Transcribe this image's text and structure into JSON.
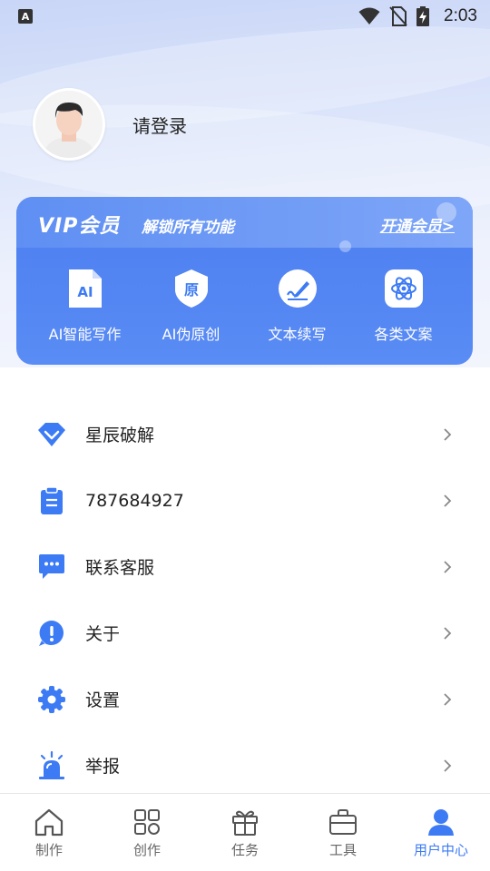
{
  "status_bar": {
    "app_badge": "A",
    "time": "2:03",
    "icons": [
      "wifi-icon",
      "no-sim-icon",
      "battery-charging-icon"
    ]
  },
  "profile": {
    "login_label": "请登录",
    "avatar_icon": "user-avatar"
  },
  "vip": {
    "title": "VIP会员",
    "subtitle": "解锁所有功能",
    "open_label": "开通会员>",
    "features": [
      {
        "label": "AI智能写作",
        "icon": "ai-document-icon"
      },
      {
        "label": "AI伪原创",
        "icon": "original-shield-icon"
      },
      {
        "label": "文本续写",
        "icon": "pen-writing-icon"
      },
      {
        "label": "各类文案",
        "icon": "atom-icon"
      }
    ]
  },
  "menu": {
    "items": [
      {
        "label": "星辰破解",
        "icon": "diamond-icon"
      },
      {
        "label": "787684927",
        "icon": "clipboard-icon"
      },
      {
        "label": "联系客服",
        "icon": "chat-icon"
      },
      {
        "label": "关于",
        "icon": "info-bubble-icon"
      },
      {
        "label": "设置",
        "icon": "gear-icon"
      },
      {
        "label": "举报",
        "icon": "alarm-siren-icon"
      }
    ]
  },
  "bottom_nav": {
    "items": [
      {
        "label": "制作",
        "icon": "home-icon"
      },
      {
        "label": "创作",
        "icon": "apps-grid-icon"
      },
      {
        "label": "任务",
        "icon": "gift-icon"
      },
      {
        "label": "工具",
        "icon": "briefcase-icon"
      },
      {
        "label": "用户中心",
        "icon": "user-icon"
      }
    ],
    "active_index": 4
  },
  "colors": {
    "accent": "#3d7bf5",
    "vip_card": "#4b7df0",
    "text": "#222222",
    "muted": "#666666"
  }
}
